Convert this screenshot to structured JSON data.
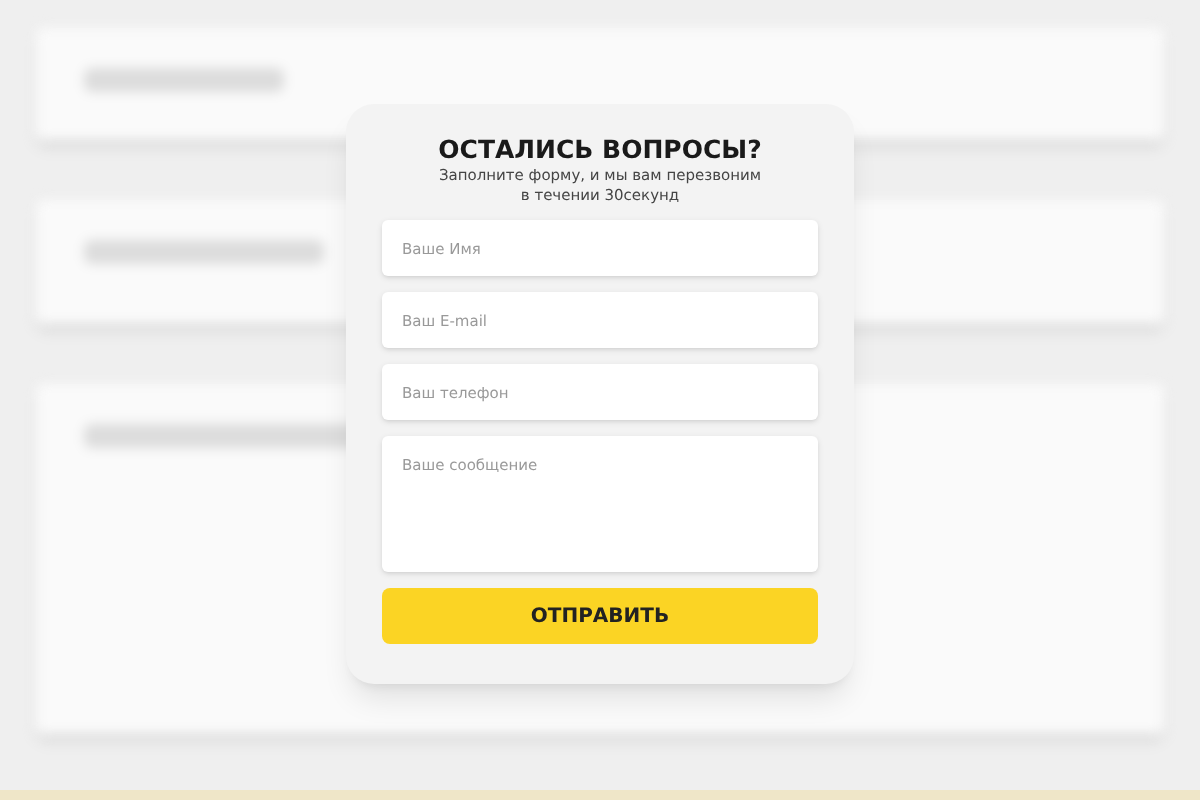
{
  "form": {
    "title": "ОСТАЛИСЬ ВОПРОСЫ?",
    "subtitle_lines": [
      "Заполните форму, и мы вам перезвоним",
      "в течении 30секунд"
    ],
    "fields": [
      {
        "kind": "input",
        "placeholder": "Ваше Имя"
      },
      {
        "kind": "input",
        "placeholder": "Ваш E-mail"
      },
      {
        "kind": "input",
        "placeholder": "Ваш телефон"
      },
      {
        "kind": "textarea",
        "placeholder": "Ваше сообщение"
      }
    ],
    "submit": "ОТПРАВИТЬ"
  }
}
